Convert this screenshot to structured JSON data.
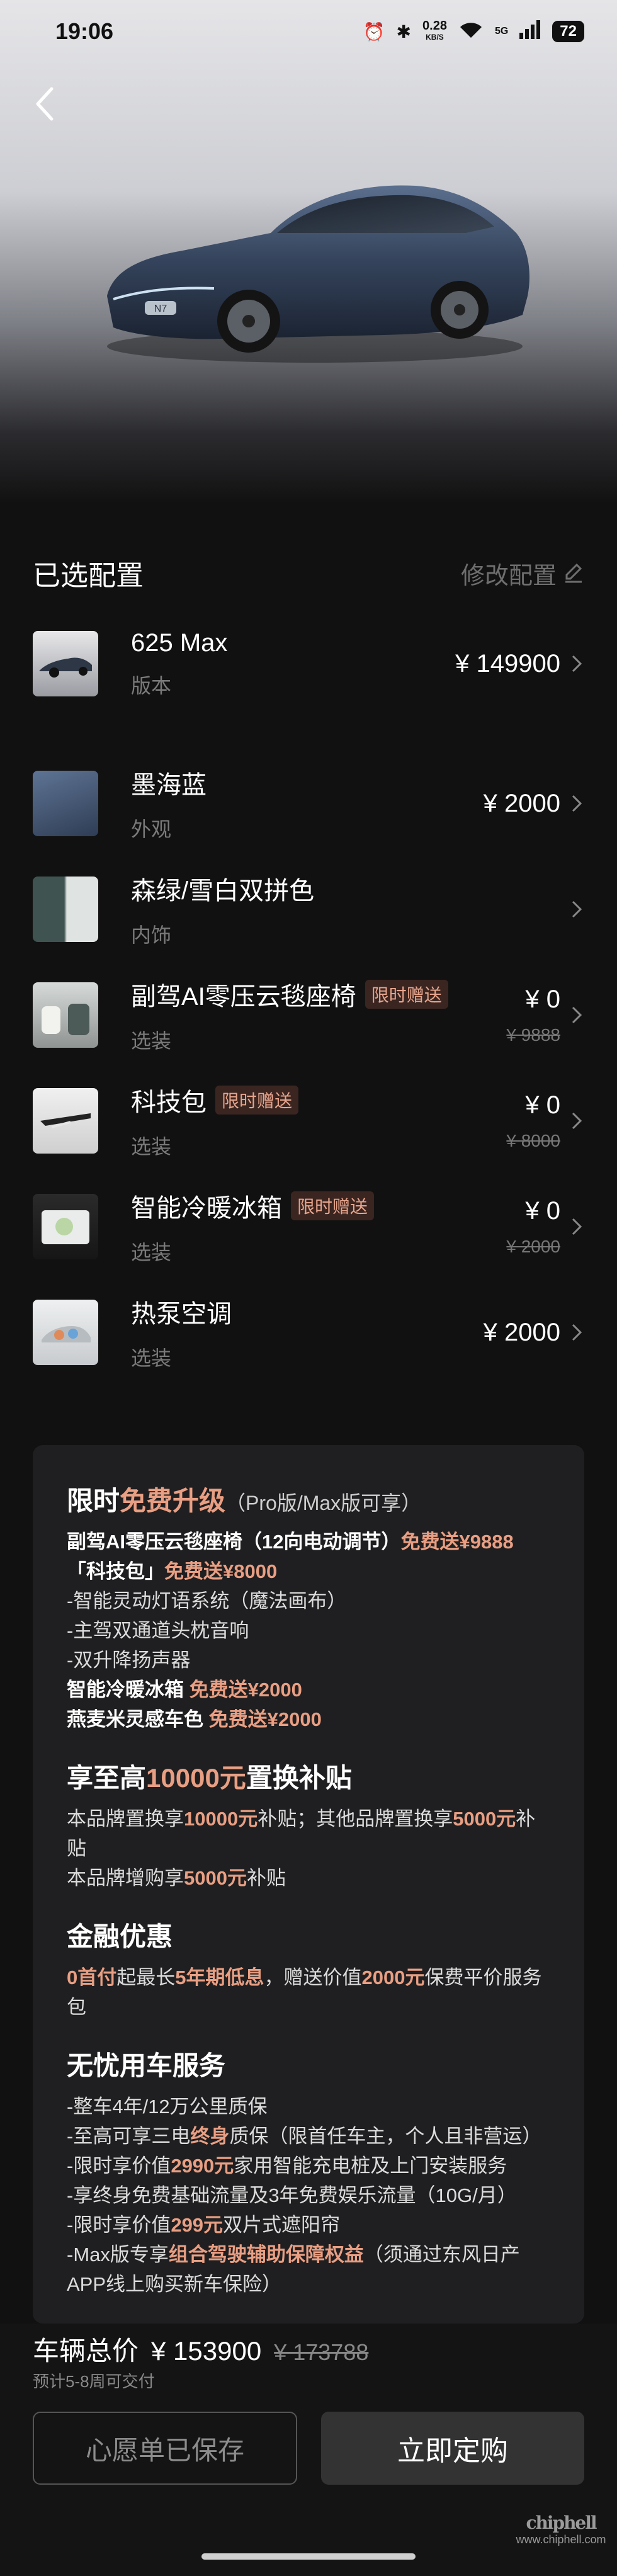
{
  "status_bar": {
    "time": "19:06",
    "network_speed": "0.28",
    "network_speed_unit": "KB/S",
    "signal": "5G",
    "battery": "72"
  },
  "header": {
    "car_model_badge": "N7"
  },
  "selected_config": {
    "title": "已选配置",
    "edit_label": "修改配置"
  },
  "config_items": [
    {
      "name": "625 Max",
      "sub": "版本",
      "price": "¥ 149900",
      "badge": "",
      "original_price": ""
    },
    {
      "name": "墨海蓝",
      "sub": "外观",
      "price": "¥ 2000",
      "badge": "",
      "original_price": ""
    },
    {
      "name": "森绿/雪白双拼色",
      "sub": "内饰",
      "price": "",
      "badge": "",
      "original_price": ""
    },
    {
      "name": "副驾AI零压云毯座椅",
      "sub": "选装",
      "price": "¥ 0",
      "badge": "限时赠送",
      "original_price": "¥ 9888"
    },
    {
      "name": "科技包",
      "sub": "选装",
      "price": "¥ 0",
      "badge": "限时赠送",
      "original_price": "¥ 8000"
    },
    {
      "name": "智能冷暖冰箱",
      "sub": "选装",
      "price": "¥ 0",
      "badge": "限时赠送",
      "original_price": "¥ 2000"
    },
    {
      "name": "热泵空调",
      "sub": "选装",
      "price": "¥ 2000",
      "badge": "",
      "original_price": ""
    }
  ],
  "colors": {
    "accent": "#e99f83",
    "exterior_swatch": "#3d4f6a",
    "interior_swatch_green": "#3f5350",
    "interior_swatch_white": "#dfe3e2"
  },
  "promo": {
    "upgrade": {
      "title_a": "限时",
      "title_b": "免费升级",
      "title_note": "（Pro版/Max版可享）",
      "l1a": "副驾AI零压云毯座椅（12向电动调节）",
      "l1b": "免费送¥9888",
      "l2a": "「科技包」",
      "l2b": "免费送¥8000",
      "l3": "-智能灵动灯语系统（魔法画布）",
      "l4": "-主驾双通道头枕音响",
      "l5": "-双升降扬声器",
      "l6a": "智能冷暖冰箱",
      "l6b": "免费送¥2000",
      "l7a": "燕麦米灵感车色",
      "l7b": "免费送¥2000"
    },
    "tradein": {
      "title_a": "享至高",
      "title_b": "10000元",
      "title_c": "置换补贴",
      "l1a": "本品牌置换享",
      "l1b": "10000元",
      "l1c": "补贴；其他品牌置换享",
      "l1d": "5000元",
      "l1e": "补贴",
      "l2a": "本品牌增购享",
      "l2b": "5000元",
      "l2c": "补贴"
    },
    "finance": {
      "title": "金融优惠",
      "l1a": "0首付",
      "l1b": "起最长",
      "l1c": "5年期低息",
      "l1d": "，赠送价值",
      "l1e": "2000元",
      "l1f": "保费平价服务包"
    },
    "service": {
      "title": "无忧用车服务",
      "l1": "-整车4年/12万公里质保",
      "l2a": "-至高可享三电",
      "l2b": "终身",
      "l2c": "质保（限首任车主，个人且非营运）",
      "l3a": "-限时享价值",
      "l3b": "2990元",
      "l3c": "家用智能充电桩及上门安装服务",
      "l4": "-享终身免费基础流量及3年免费娱乐流量（10G/月）",
      "l5a": "-限时享价值",
      "l5b": "299元",
      "l5c": "双片式遮阳帘",
      "l6a": "-Max版专享",
      "l6b": "组合驾驶辅助保障权益",
      "l6c": "（须通过东风日产APP线上购买新车保险）"
    }
  },
  "footer": {
    "total_label": "车辆总价",
    "total_price": "¥ 153900",
    "original_total": "¥ 173788",
    "delivery_note": "预计5-8周可交付",
    "wishlist_label": "心愿单已保存",
    "order_label": "立即定购",
    "watermark_logo": "chiphell",
    "watermark_url": "www.chiphell.com"
  }
}
